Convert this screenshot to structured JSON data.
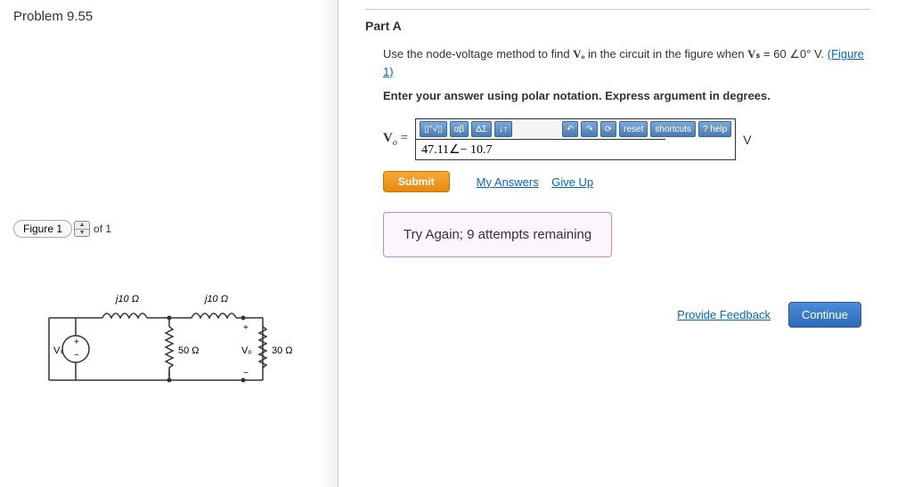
{
  "left": {
    "problem_title": "Problem 9.55",
    "figure_button": "Figure 1",
    "of_text": "of 1",
    "circuit": {
      "L1": "j10 Ω",
      "L2": "j10 Ω",
      "R1": "50 Ω",
      "R2": "30 Ω",
      "Vs": "Vₛ",
      "Vo": "Vₒ",
      "plus": "+",
      "minus": "−"
    }
  },
  "right": {
    "part_label": "Part A",
    "instruction_pre": "Use the node-voltage method to find ",
    "instruction_vo": "Vₒ",
    "instruction_mid": " in the circuit in the figure when ",
    "instruction_vs": "Vₛ",
    "instruction_eq": " = 60 ∠0° V.",
    "figure_link": "(Figure 1)",
    "bold_instruction": "Enter your answer using polar notation. Express argument in degrees.",
    "vo_label": "Vₒ =",
    "toolbar": {
      "templates": "▯°√▯",
      "greek": "αβ",
      "symbols": "ΔΣ",
      "arrows": "↓↑",
      "undo": "↶",
      "redo": "↷",
      "refresh": "⟳",
      "reset": "reset",
      "shortcuts": "shortcuts",
      "help": "? help"
    },
    "answer_value": "47.11∠− 10.7",
    "unit": "V",
    "submit": "Submit",
    "my_answers": "My Answers",
    "give_up": "Give Up",
    "feedback": "Try Again; 9 attempts remaining",
    "provide_feedback": "Provide Feedback",
    "continue": "Continue"
  }
}
